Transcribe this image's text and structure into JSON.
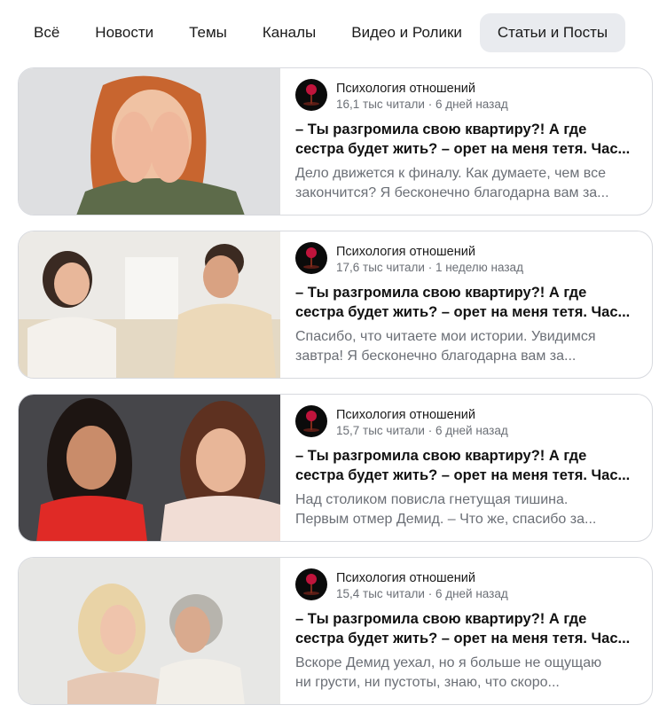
{
  "tabs": [
    {
      "label": "Всё",
      "active": false
    },
    {
      "label": "Новости",
      "active": false
    },
    {
      "label": "Темы",
      "active": false
    },
    {
      "label": "Каналы",
      "active": false
    },
    {
      "label": "Видео и Ролики",
      "active": false
    },
    {
      "label": "Статьи и Посты",
      "active": true
    }
  ],
  "cards": [
    {
      "channel": "Психология отношений",
      "meta": "16,1 тыс читали · 6 дней назад",
      "title_line1": "– Ты разгромила свою квартиру?! А где",
      "title_line2": "сестра будет жить? – орет на меня тетя. Час...",
      "snippet_line1": "Дело движется к финалу. Как думаете, чем все",
      "snippet_line2": "закончится? Я бесконечно благодарна вам за..."
    },
    {
      "channel": "Психология отношений",
      "meta": "17,6 тыс читали · 1 неделю назад",
      "title_line1": "– Ты разгромила свою квартиру?! А где",
      "title_line2": "сестра будет жить? – орет на меня тетя. Час...",
      "snippet_line1": "Спасибо, что читаете мои истории. Увидимся",
      "snippet_line2": "завтра! Я бесконечно благодарна вам за..."
    },
    {
      "channel": "Психология отношений",
      "meta": "15,7 тыс читали · 6 дней назад",
      "title_line1": "– Ты разгромила свою квартиру?! А где",
      "title_line2": "сестра будет жить? – орет на меня тетя. Час...",
      "snippet_line1": "Над столиком повисла гнетущая тишина.",
      "snippet_line2": "Первым отмер Демид. – Что же, спасибо за..."
    },
    {
      "channel": "Психология отношений",
      "meta": "15,4 тыс читали · 6 дней назад",
      "title_line1": "– Ты разгромила свою квартиру?! А где",
      "title_line2": "сестра будет жить? – орет на меня тетя. Час...",
      "snippet_line1": "Вскоре Демид уехал, но я больше не ощущаю",
      "snippet_line2": "ни грусти, ни пустоты, знаю, что скоро..."
    }
  ],
  "colors": {
    "tab_active_bg": "#e9ebef",
    "meta_text": "#6b6f76",
    "card_border": "#d7d9de"
  }
}
